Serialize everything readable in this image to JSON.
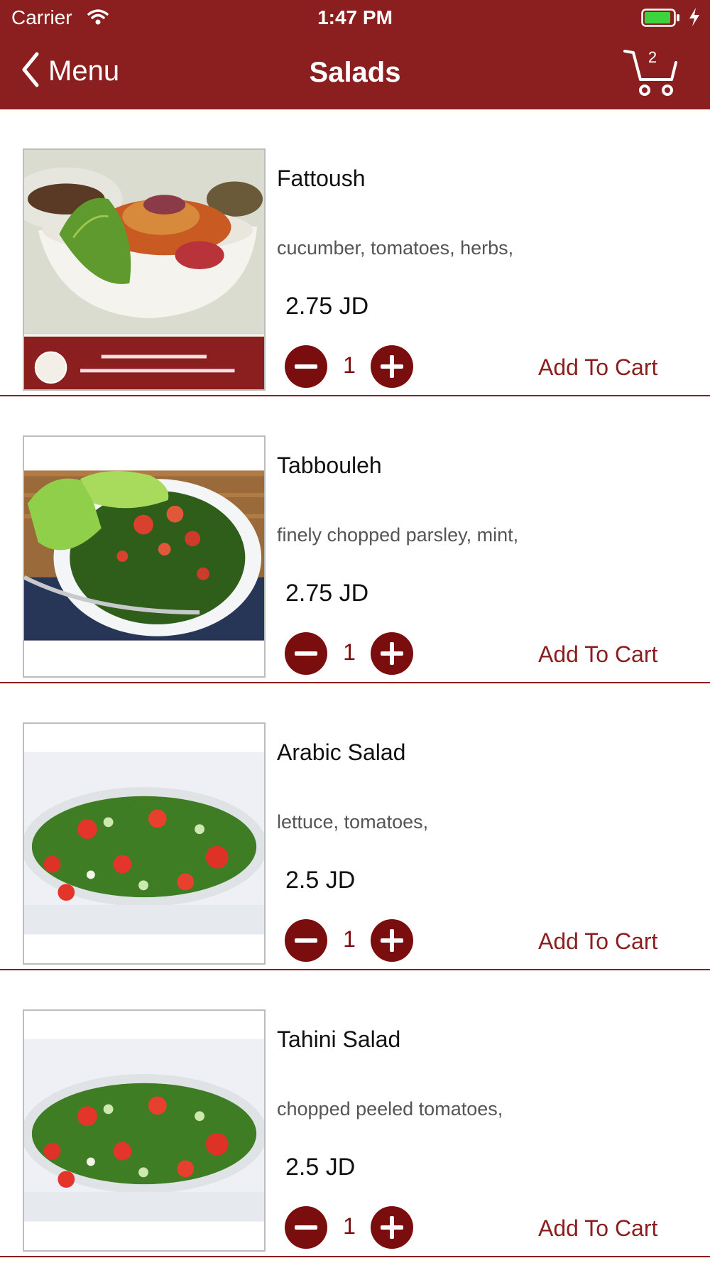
{
  "status_bar": {
    "carrier": "Carrier",
    "time": "1:47 PM"
  },
  "nav": {
    "back_label": "Menu",
    "title": "Salads",
    "cart_count": "2"
  },
  "colors": {
    "brand": "#8b1f1f",
    "button": "#7a0d0d",
    "battery": "#3fd23f"
  },
  "items": [
    {
      "name": "Fattoush",
      "description": "cucumber, tomatoes, herbs,",
      "price": "2.75 JD",
      "quantity": "1",
      "add_label": "Add To Cart",
      "image": "fattoush-photo"
    },
    {
      "name": "Tabbouleh",
      "description": "finely chopped parsley, mint,",
      "price": "2.75 JD",
      "quantity": "1",
      "add_label": "Add To Cart",
      "image": "tabbouleh-photo"
    },
    {
      "name": "Arabic Salad",
      "description": "lettuce, tomatoes,",
      "price": "2.5 JD",
      "quantity": "1",
      "add_label": "Add To Cart",
      "image": "arabic-salad-photo"
    },
    {
      "name": "Tahini Salad",
      "description": "chopped peeled tomatoes,",
      "price": "2.5 JD",
      "quantity": "1",
      "add_label": "Add To Cart",
      "image": "tahini-salad-photo"
    }
  ]
}
